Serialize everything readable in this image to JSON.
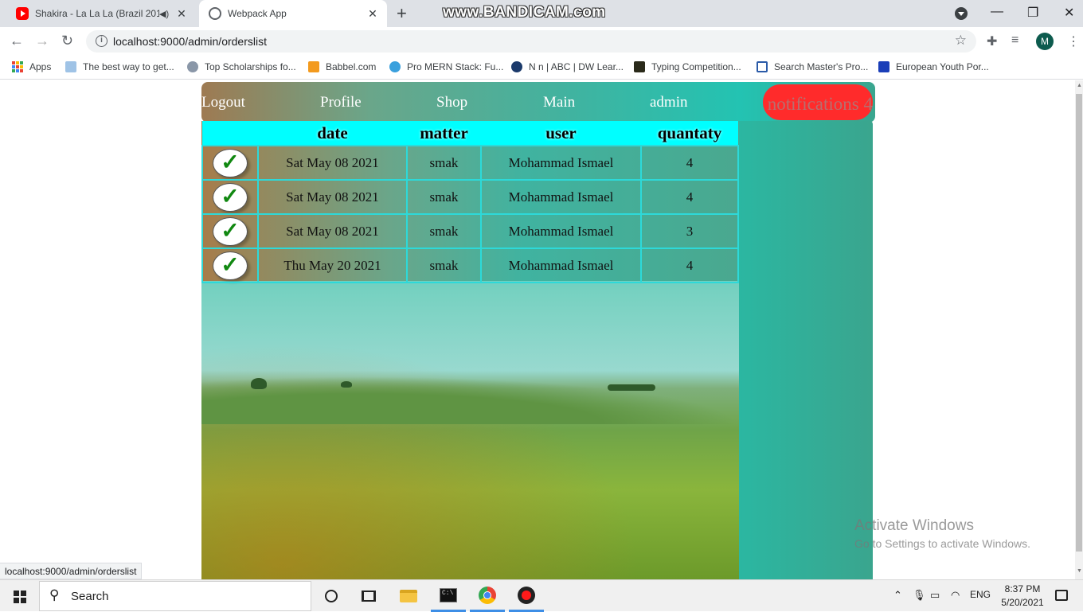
{
  "browser": {
    "tabs": [
      {
        "title": "Shakira - La La La (Brazil 2014)",
        "active": false
      },
      {
        "title": "Webpack App",
        "active": true
      }
    ],
    "new_tab_symbol": "+",
    "recorder_watermark": "www.BANDICAM.com",
    "url": "localhost:9000/admin/orderslist",
    "profile_initial": "M",
    "bookmarks": [
      {
        "label": "Apps",
        "icon": "apps-grid-icon"
      },
      {
        "label": "The best way to get...",
        "icon": "bank-icon"
      },
      {
        "label": "Top Scholarships fo...",
        "icon": "scholarship-icon"
      },
      {
        "label": "Babbel.com",
        "icon": "babbel-icon"
      },
      {
        "label": "Pro MERN Stack: Fu...",
        "icon": "book-icon"
      },
      {
        "label": "N n | ABC | DW Lear...",
        "icon": "dw-icon"
      },
      {
        "label": "Typing Competition...",
        "icon": "typing-icon"
      },
      {
        "label": "Search Master's Pro...",
        "icon": "university-icon"
      },
      {
        "label": "European Youth Por...",
        "icon": "eu-flag-icon"
      }
    ],
    "status_url": "localhost:9000/admin/orderslist"
  },
  "navbar": {
    "links": [
      {
        "label": "Logout"
      },
      {
        "label": "Profile"
      },
      {
        "label": "Shop"
      },
      {
        "label": "Main"
      },
      {
        "label": "admin"
      }
    ],
    "notifications_label": "notifications 4"
  },
  "orders": {
    "columns": [
      "",
      "date",
      "matter",
      "user",
      "quantaty"
    ],
    "rows": [
      {
        "date": "Sat May 08 2021",
        "matter": "smak",
        "user": "Mohammad Ismael",
        "quantity": "4"
      },
      {
        "date": "Sat May 08 2021",
        "matter": "smak",
        "user": "Mohammad Ismael",
        "quantity": "4"
      },
      {
        "date": "Sat May 08 2021",
        "matter": "smak",
        "user": "Mohammad Ismael",
        "quantity": "3"
      },
      {
        "date": "Thu May 20 2021",
        "matter": "smak",
        "user": "Mohammad Ismael",
        "quantity": "4"
      }
    ],
    "check_symbol": "✓"
  },
  "activate_windows": {
    "title": "Activate Windows",
    "subtitle": "Go to Settings to activate Windows."
  },
  "taskbar": {
    "search_placeholder": "Search",
    "language": "ENG",
    "time": "8:37 PM",
    "date": "5/20/2021"
  },
  "colors": {
    "notification_badge": "#ff2b2b",
    "table_header": "#00ffff",
    "table_border": "#2dd9d9",
    "check_mark": "#118811"
  }
}
